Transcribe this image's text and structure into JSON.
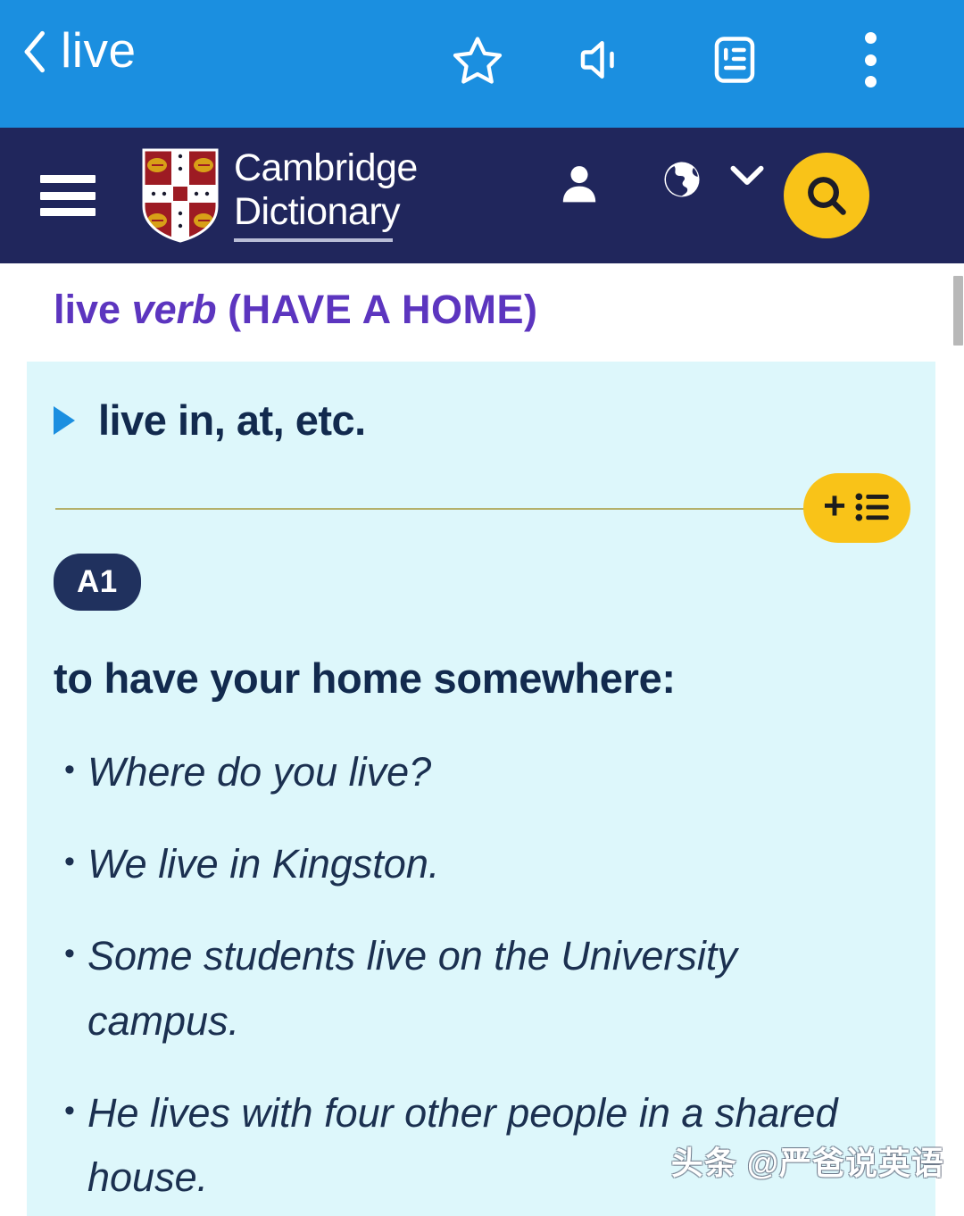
{
  "appbar": {
    "back_label": "back-button",
    "title": "live",
    "icons": [
      {
        "name": "star-icon",
        "label": "Favourite"
      },
      {
        "name": "speaker-icon",
        "label": "Pronounce"
      },
      {
        "name": "article-icon",
        "label": "Article view"
      },
      {
        "name": "more-menu-icon",
        "label": "More options"
      }
    ],
    "background_color": "#1b8fe0"
  },
  "site_header": {
    "menu_label": "Menu",
    "brand_line1": "Cambridge",
    "brand_line2": "Dictionary",
    "crest_label": "cambridge-crest",
    "account_label": "My account",
    "language_label": "Language",
    "search_label": "Search",
    "background_color": "#20265c",
    "accent_color": "#f9c318"
  },
  "entry": {
    "headword": "live",
    "part_of_speech": "verb",
    "guide_word": "(HAVE A HOME)",
    "headword_color": "#5c35bf",
    "phrase": "live in, at, etc.",
    "wordlist_button": {
      "plus": "+",
      "label": "Add to word list"
    },
    "level": "A1",
    "definition": "to have your home somewhere:",
    "examples": [
      "Where do you live?",
      "We live in Kingston.",
      "Some students live on the University campus.",
      "He lives with four other people in a shared house."
    ],
    "card_background": "#ddf7fb",
    "text_color": "#122a4e"
  },
  "watermark": {
    "text": "头条 @严爸说英语"
  }
}
